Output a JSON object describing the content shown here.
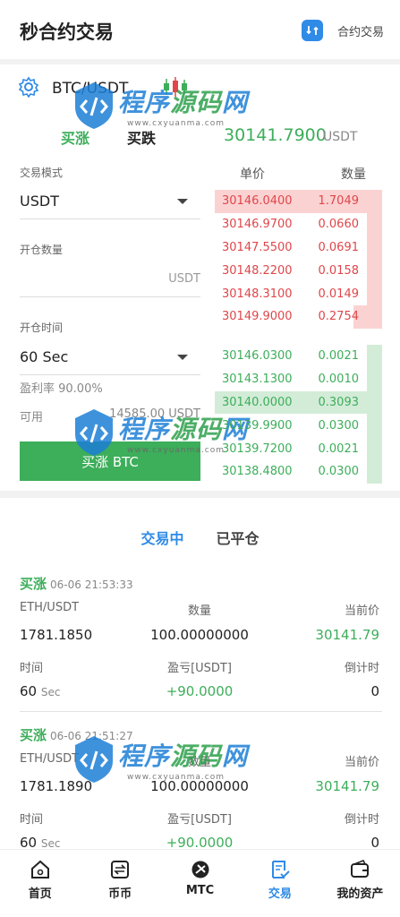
{
  "header": {
    "title": "秒合约交易",
    "switch_label": "合约交易"
  },
  "pair": {
    "symbol": "BTC/USDT"
  },
  "direction_tabs": {
    "up": "买涨",
    "down": "买跌"
  },
  "last_price": {
    "value": "30141.7900",
    "unit": "USDT"
  },
  "form": {
    "mode_label": "交易模式",
    "mode_value": "USDT",
    "qty_label": "开仓数量",
    "qty_unit": "USDT",
    "time_label": "开仓时间",
    "time_value": "60 Sec",
    "profit_rate": "盈利率 90.00%",
    "available_label": "可用",
    "available_value": "14585.00 USDT",
    "buy_button": "买涨 BTC"
  },
  "order_book": {
    "price_header": "单价",
    "qty_header": "数量",
    "asks": [
      {
        "price": "30146.0400",
        "qty": "1.7049",
        "depth": 1.0
      },
      {
        "price": "30146.9700",
        "qty": "0.0660",
        "depth": 0.09
      },
      {
        "price": "30147.5500",
        "qty": "0.0691",
        "depth": 0.09
      },
      {
        "price": "30148.2200",
        "qty": "0.0158",
        "depth": 0.09
      },
      {
        "price": "30148.3100",
        "qty": "0.0149",
        "depth": 0.09
      },
      {
        "price": "30149.9000",
        "qty": "0.2754",
        "depth": 0.17
      }
    ],
    "bids": [
      {
        "price": "30146.0300",
        "qty": "0.0021",
        "depth": 0.09
      },
      {
        "price": "30143.1300",
        "qty": "0.0010",
        "depth": 0.09
      },
      {
        "price": "30140.0000",
        "qty": "0.3093",
        "depth": 1.0
      },
      {
        "price": "30139.9900",
        "qty": "0.0300",
        "depth": 0.09
      },
      {
        "price": "30139.7200",
        "qty": "0.0021",
        "depth": 0.09
      },
      {
        "price": "30138.4800",
        "qty": "0.0300",
        "depth": 0.09
      }
    ]
  },
  "order_tabs": {
    "active": "交易中",
    "closed": "已平仓"
  },
  "orders": [
    {
      "direction": "买涨",
      "time": "06-06 21:53:33",
      "pair": "ETH/USDT",
      "qty_label": "数量",
      "current_label": "当前价",
      "open_price": "1781.1850",
      "qty": "100.00000000",
      "current_price": "30141.79",
      "time_label": "时间",
      "pnl_label": "盈亏[USDT]",
      "countdown_label": "倒计时",
      "duration": "60",
      "duration_unit": "Sec",
      "pnl": "+90.0000",
      "countdown": "0"
    },
    {
      "direction": "买涨",
      "time": "06-06 21:51:27",
      "pair": "ETH/USDT",
      "qty_label": "数量",
      "current_label": "当前价",
      "open_price": "1781.1890",
      "qty": "100.00000000",
      "current_price": "30141.79",
      "time_label": "时间",
      "pnl_label": "盈亏[USDT]",
      "countdown_label": "倒计时",
      "duration": "60",
      "duration_unit": "Sec",
      "pnl": "+90.0000",
      "countdown": "0"
    }
  ],
  "tabbar": [
    {
      "label": "首页",
      "icon": "home-icon"
    },
    {
      "label": "币币",
      "icon": "exchange-icon"
    },
    {
      "label": "MTC",
      "icon": "mtc-icon"
    },
    {
      "label": "交易",
      "icon": "trade-icon"
    },
    {
      "label": "我的资产",
      "icon": "wallet-icon"
    }
  ],
  "watermark": {
    "main": "程序源码网",
    "url": "www.cxyuanma.com"
  },
  "colors": {
    "up": "#3dae5a",
    "down": "#e0464a",
    "accent": "#2f8be6"
  }
}
